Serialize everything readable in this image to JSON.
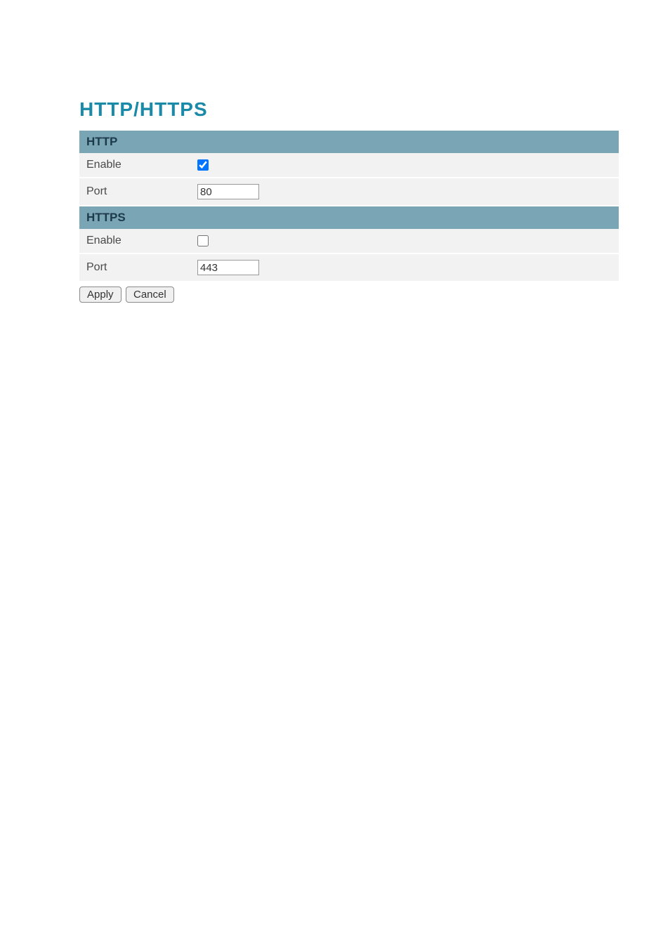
{
  "page": {
    "title": "HTTP/HTTPS"
  },
  "sections": {
    "http": {
      "header": "HTTP",
      "enable_label": "Enable",
      "enable_checked": true,
      "port_label": "Port",
      "port_value": "80"
    },
    "https": {
      "header": "HTTPS",
      "enable_label": "Enable",
      "enable_checked": false,
      "port_label": "Port",
      "port_value": "443"
    }
  },
  "buttons": {
    "apply": "Apply",
    "cancel": "Cancel"
  }
}
